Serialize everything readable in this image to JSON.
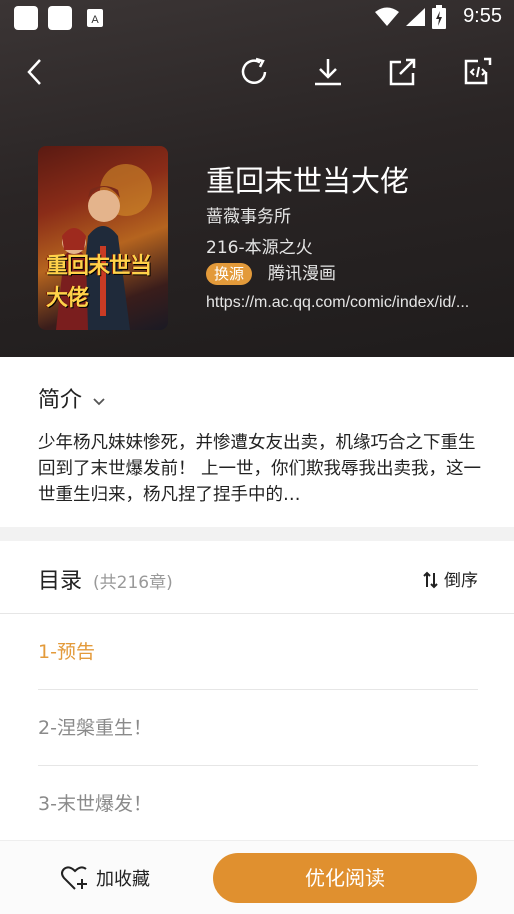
{
  "status_bar": {
    "time": "9:55"
  },
  "book": {
    "title": "重回末世当大佬",
    "author": "蔷薇事务所",
    "latest_chapter": "216-本源之火",
    "source_tag": "换源",
    "source_name": "腾讯漫画",
    "url": "https://m.ac.qq.com/comic/index/id/...",
    "cover_text": "重回末世当大佬"
  },
  "intro": {
    "heading": "简介",
    "text": "少年杨凡妹妹惨死，并惨遭女友出卖，机缘巧合之下重生回到了末世爆发前！ 上一世，你们欺我辱我出卖我，这一世重生归来，杨凡捏了捏手中的…"
  },
  "toc": {
    "heading": "目录",
    "count": "(共216章)",
    "sort_label": "倒序",
    "chapters": [
      {
        "title": "1-预告",
        "active": true
      },
      {
        "title": "2-涅槃重生！",
        "active": false
      },
      {
        "title": "3-末世爆发！",
        "active": false
      }
    ]
  },
  "bottom": {
    "favorite_label": "加收藏",
    "read_label": "优化阅读"
  },
  "colors": {
    "accent": "#e0902f",
    "header_bg": "#2a2525"
  },
  "icons": [
    "back-icon",
    "refresh-icon",
    "download-icon",
    "share-icon",
    "source-code-icon",
    "chevron-down-icon",
    "sort-icon",
    "heart-plus-icon"
  ]
}
